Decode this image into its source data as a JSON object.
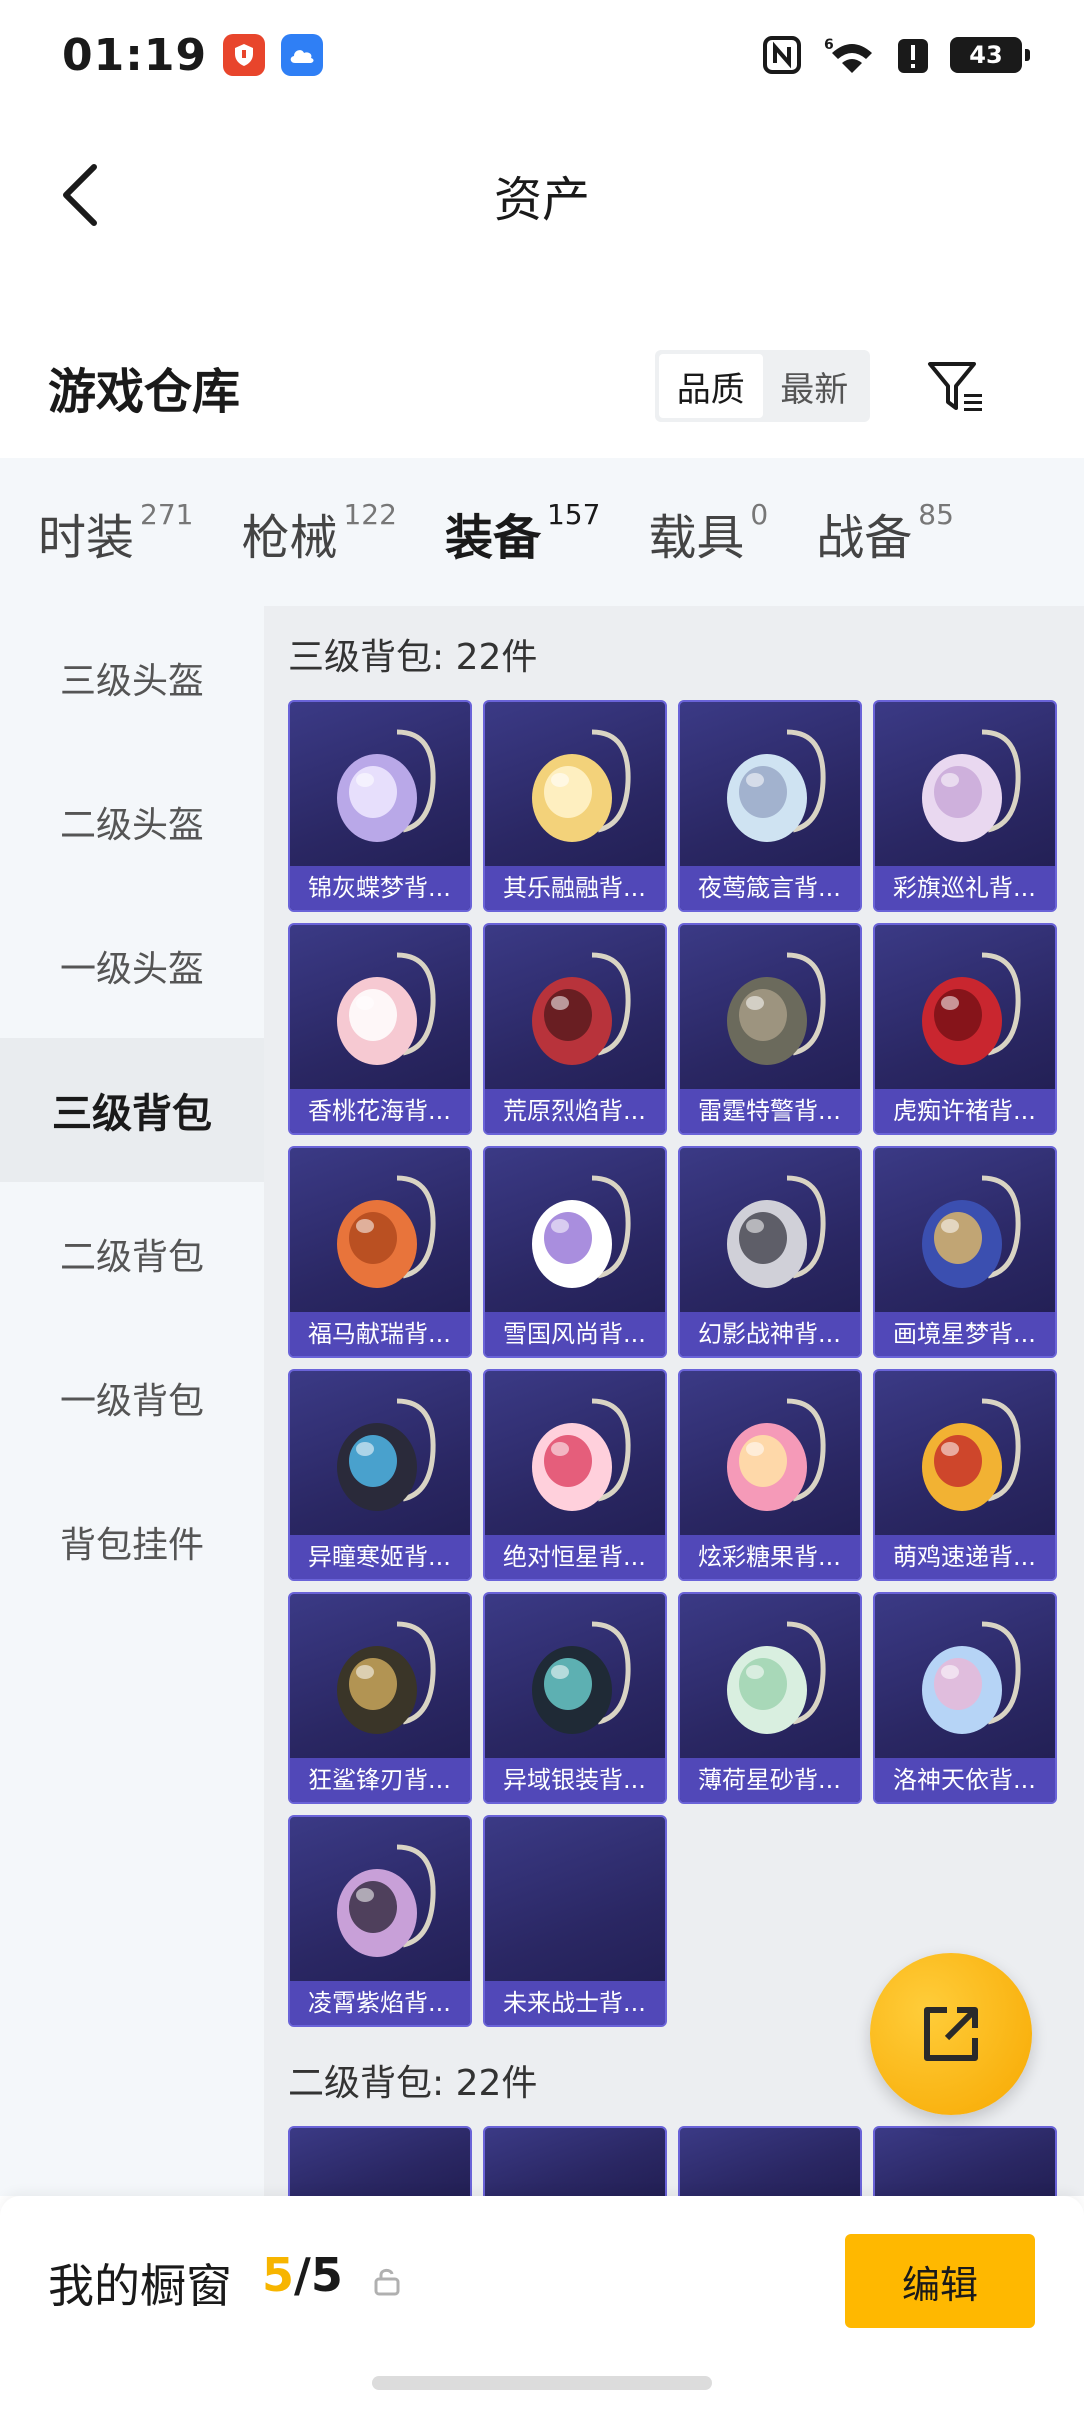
{
  "status_bar": {
    "time": "01:19",
    "battery": "43",
    "icons": [
      "security-app-icon",
      "cloud-app-icon",
      "nfc-icon",
      "wifi-6-icon",
      "alert-icon",
      "battery-icon"
    ]
  },
  "header": {
    "title": "资产"
  },
  "warehouse": {
    "title": "游戏仓库",
    "sort_options": [
      "品质",
      "最新"
    ],
    "active_sort": "品质"
  },
  "tabs": [
    {
      "label": "时装",
      "count": "271"
    },
    {
      "label": "枪械",
      "count": "122"
    },
    {
      "label": "装备",
      "count": "157"
    },
    {
      "label": "载具",
      "count": "0"
    },
    {
      "label": "战备",
      "count": "85"
    }
  ],
  "active_tab": "装备",
  "sidebar": [
    {
      "label": "三级头盔"
    },
    {
      "label": "二级头盔"
    },
    {
      "label": "一级头盔"
    },
    {
      "label": "三级背包"
    },
    {
      "label": "二级背包"
    },
    {
      "label": "一级背包"
    },
    {
      "label": "背包挂件"
    }
  ],
  "active_sidebar": "三级背包",
  "sections": [
    {
      "title": "三级背包: 22件",
      "items": [
        {
          "name": "锦灰蝶梦背..."
        },
        {
          "name": "其乐融融背..."
        },
        {
          "name": "夜莺箴言背..."
        },
        {
          "name": "彩旗巡礼背..."
        },
        {
          "name": "香桃花海背..."
        },
        {
          "name": "荒原烈焰背..."
        },
        {
          "name": "雷霆特警背..."
        },
        {
          "name": "虎痴许褚背..."
        },
        {
          "name": "福马献瑞背..."
        },
        {
          "name": "雪国风尚背..."
        },
        {
          "name": "幻影战神背..."
        },
        {
          "name": "画境星梦背..."
        },
        {
          "name": "异瞳寒姬背..."
        },
        {
          "name": "绝对恒星背..."
        },
        {
          "name": "炫彩糖果背..."
        },
        {
          "name": "萌鸡速递背..."
        },
        {
          "name": "狂鲨锋刃背..."
        },
        {
          "name": "异域银装背..."
        },
        {
          "name": "薄荷星砂背..."
        },
        {
          "name": "洛神天依背..."
        },
        {
          "name": "凌霄紫焰背..."
        },
        {
          "name": "未来战士背..."
        }
      ]
    },
    {
      "title": "二级背包: 22件"
    }
  ],
  "showcase": {
    "label": "我的橱窗",
    "current": "5",
    "separator": "/",
    "max": "5",
    "edit_label": "编辑"
  },
  "colors": {
    "accent": "#f7b500",
    "card_bg": "#2a2763",
    "card_label_bg": "#5148b8"
  }
}
